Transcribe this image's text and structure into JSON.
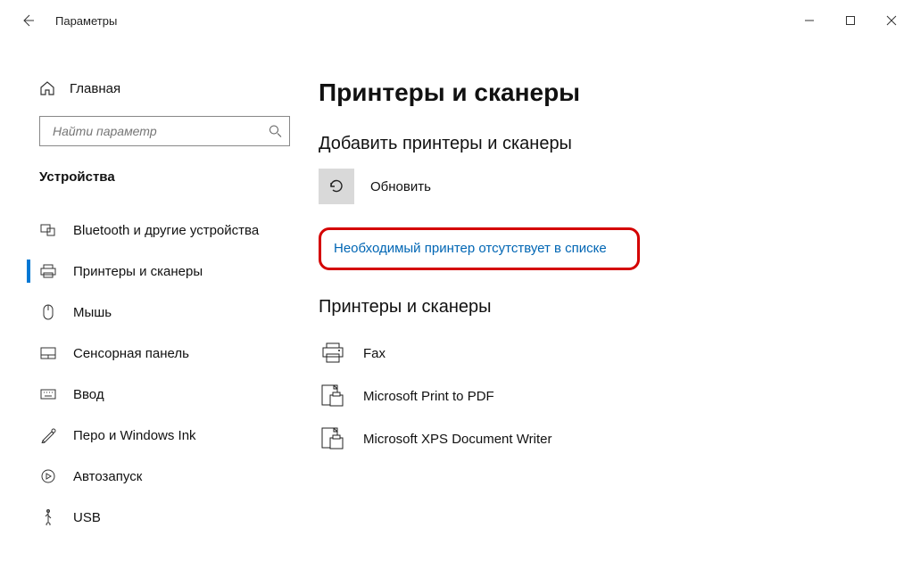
{
  "app_title": "Параметры",
  "search": {
    "placeholder": "Найти параметр"
  },
  "home_label": "Главная",
  "section_label": "Устройства",
  "nav": [
    {
      "label": "Bluetooth и другие устройства"
    },
    {
      "label": "Принтеры и сканеры"
    },
    {
      "label": "Мышь"
    },
    {
      "label": "Сенсорная панель"
    },
    {
      "label": "Ввод"
    },
    {
      "label": "Перо и Windows Ink"
    },
    {
      "label": "Автозапуск"
    },
    {
      "label": "USB"
    }
  ],
  "page_title": "Принтеры и сканеры",
  "add_section_title": "Добавить принтеры и сканеры",
  "refresh_label": "Обновить",
  "missing_printer_link": "Необходимый принтер отсутствует в списке",
  "printers_title": "Принтеры и сканеры",
  "printers": [
    {
      "name": "Fax"
    },
    {
      "name": "Microsoft Print to PDF"
    },
    {
      "name": "Microsoft XPS Document Writer"
    }
  ]
}
